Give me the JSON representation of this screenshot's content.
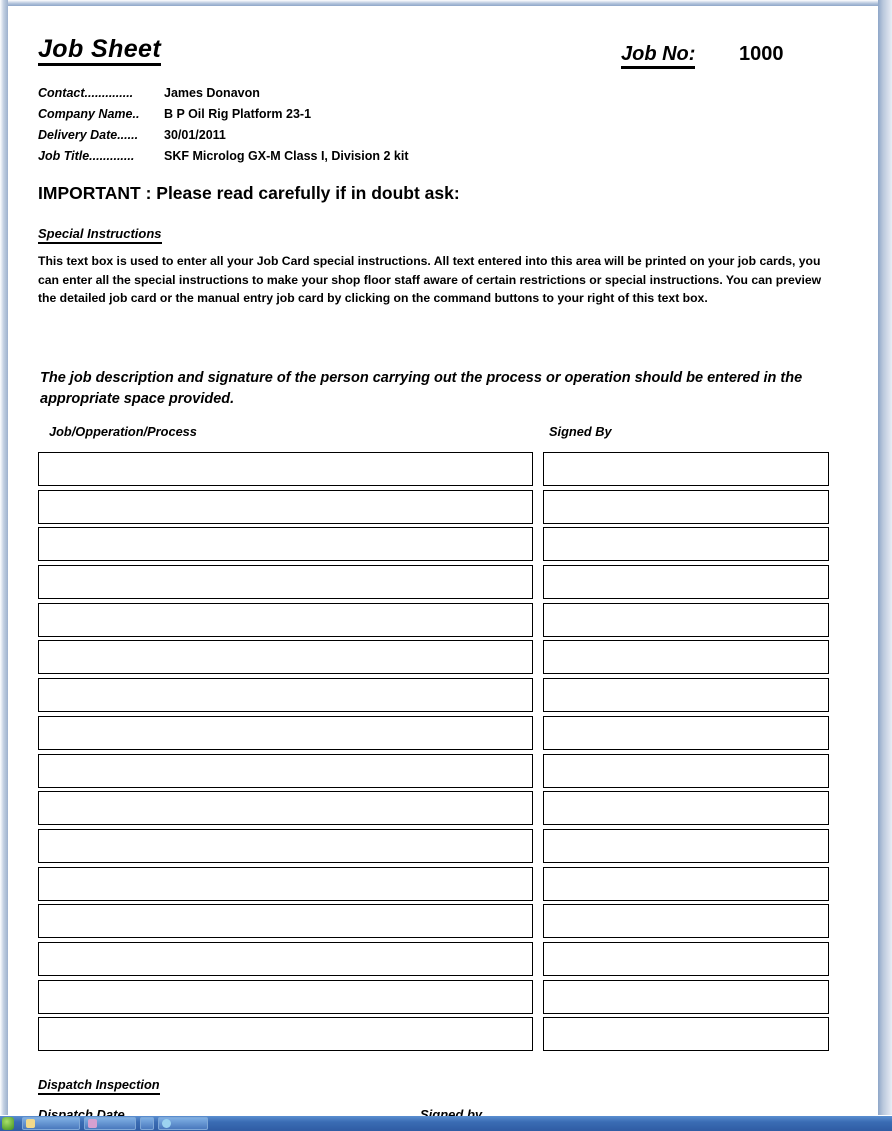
{
  "document": {
    "title": "Job Sheet",
    "job_no_label": "Job No:",
    "job_no_value": "1000"
  },
  "meta": {
    "rows": [
      {
        "label": "Contact..............",
        "value": "James Donavon"
      },
      {
        "label": "Company Name..",
        "value": "B P Oil Rig Platform 23-1"
      },
      {
        "label": "Delivery Date......",
        "value": "30/01/2011"
      },
      {
        "label": "Job Title.............",
        "value": "SKF Microlog GX-M Class I, Division 2 kit"
      }
    ]
  },
  "notice": {
    "important": "IMPORTANT : Please read carefully if in doubt ask:"
  },
  "special_instructions": {
    "heading": "Special Instructions",
    "body": "This text box is used to enter all your Job Card special instructions. All text entered into this area will be printed on your job cards, you can enter all the special instructions to make your shop floor staff aware of certain restrictions or special instructions. You can preview the detailed job card or the manual entry job card by clicking on the command buttons to your right of this text box."
  },
  "entry_section": {
    "instruction": "The job description and signature of the person carrying out the process or operation should be entered in the appropriate space provided.",
    "column_headers": {
      "task": "Job/Opperation/Process",
      "signed": "Signed By"
    },
    "row_count": 16,
    "rows": [
      {
        "task": "",
        "signed": ""
      },
      {
        "task": "",
        "signed": ""
      },
      {
        "task": "",
        "signed": ""
      },
      {
        "task": "",
        "signed": ""
      },
      {
        "task": "",
        "signed": ""
      },
      {
        "task": "",
        "signed": ""
      },
      {
        "task": "",
        "signed": ""
      },
      {
        "task": "",
        "signed": ""
      },
      {
        "task": "",
        "signed": ""
      },
      {
        "task": "",
        "signed": ""
      },
      {
        "task": "",
        "signed": ""
      },
      {
        "task": "",
        "signed": ""
      },
      {
        "task": "",
        "signed": ""
      },
      {
        "task": "",
        "signed": ""
      },
      {
        "task": "",
        "signed": ""
      },
      {
        "task": "",
        "signed": ""
      }
    ]
  },
  "dispatch": {
    "heading": "Dispatch Inspection",
    "date_label": "Dispatch Date",
    "signed_label": "Signed by"
  },
  "colors": {
    "ink": "#000000",
    "page": "#ffffff",
    "window_frame": "#8ea6c8",
    "taskbar": "#3a6cb4"
  }
}
